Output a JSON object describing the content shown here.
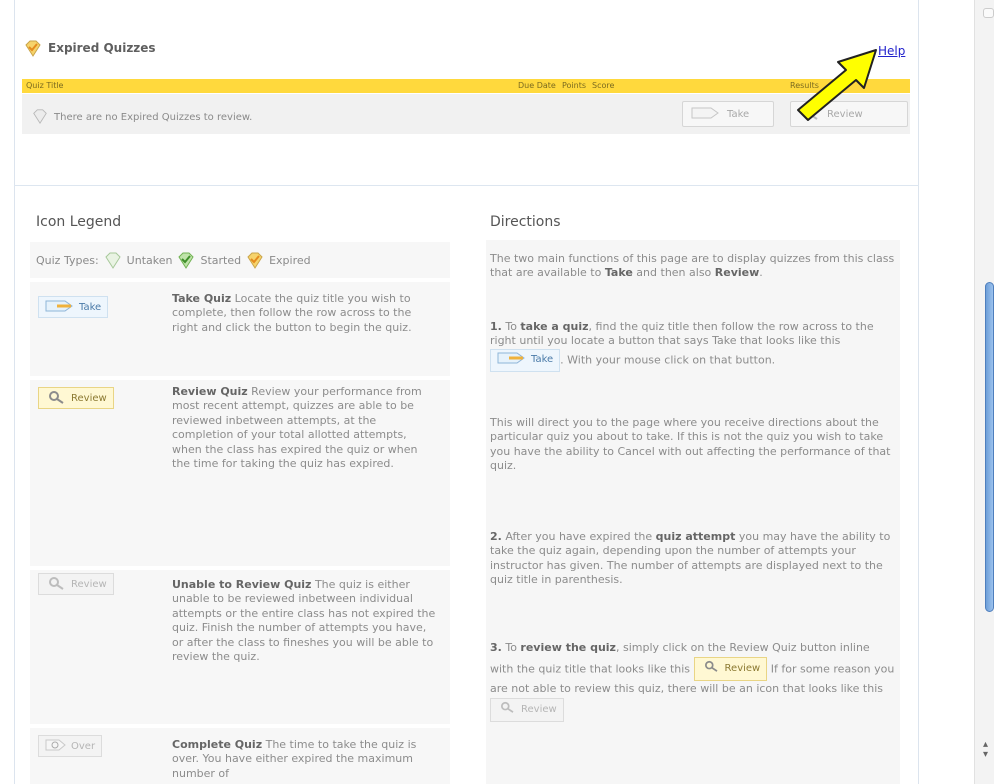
{
  "section": {
    "title": "Expired Quizzes",
    "help": "Help"
  },
  "table": {
    "headers": [
      "Quiz Title",
      "Due Date",
      "Points",
      "Score",
      "Results"
    ],
    "empty_message": "There are no Expired Quizzes to review.",
    "take_label": "Take",
    "review_label": "Review"
  },
  "legend": {
    "title": "Icon Legend",
    "quiz_types_label": "Quiz Types:",
    "types": [
      "Untaken",
      "Started",
      "Expired"
    ],
    "items": [
      {
        "button": "Take",
        "heading": "Take Quiz",
        "text": " Locate the quiz title you wish to complete, then follow the row across to the right and click the button to begin the quiz."
      },
      {
        "button": "Review",
        "heading": "Review Quiz",
        "text": " Review your performance from most recent attempt, quizzes are able to be reviewed inbetween attempts, at the completion of your total allotted attempts, when the class has expired the quiz or when the time for taking the quiz has expired."
      },
      {
        "button": "Review",
        "heading": "Unable to Review Quiz",
        "text": " The quiz is either unable to be reviewed inbetween individual attempts or the entire class has not expired the quiz. Finish the number of attempts you have, or after the class to fineshes you will be able to review the quiz."
      },
      {
        "button": "Over",
        "heading": "Complete Quiz",
        "text": " The time to take the quiz is over. You have either expired the maximum number of"
      }
    ]
  },
  "directions": {
    "title": "Directions",
    "intro_a": "The two main functions of this page are to display quizzes from this class that are available to ",
    "intro_take": "Take",
    "intro_b": " and then also ",
    "intro_review": "Review",
    "intro_c": ".",
    "p1_num": "1.",
    "p1_a": " To ",
    "p1_bold": "take a quiz",
    "p1_b": ", find the quiz title then follow the row across to the right until you locate a button that says Take that looks like this",
    "p1_btn": "Take",
    "p1_c": ". With your mouse click on that button.",
    "p1_d": "This will direct you to the page where you receive directions about the particular quiz you about to take. If this is not the quiz you wish to take you have the ability to Cancel with out affecting the performance of that quiz.",
    "p2_num": "2.",
    "p2_a": " After you have expired the ",
    "p2_bold": "quiz attempt",
    "p2_b": " you may have the ability to take the quiz again, depending upon the number of attempts your instructor has given. The number of attempts are displayed next to the quiz title in parenthesis.",
    "p3_num": "3.",
    "p3_a": " To ",
    "p3_bold": "review the quiz",
    "p3_b": ", simply click on the Review Quiz button inline with the quiz title that looks like this",
    "p3_btn": "Review",
    "p3_c": " If for some reason you are not able to review this quiz, there will be an icon that looks like this",
    "p3_btn2": "Review"
  }
}
